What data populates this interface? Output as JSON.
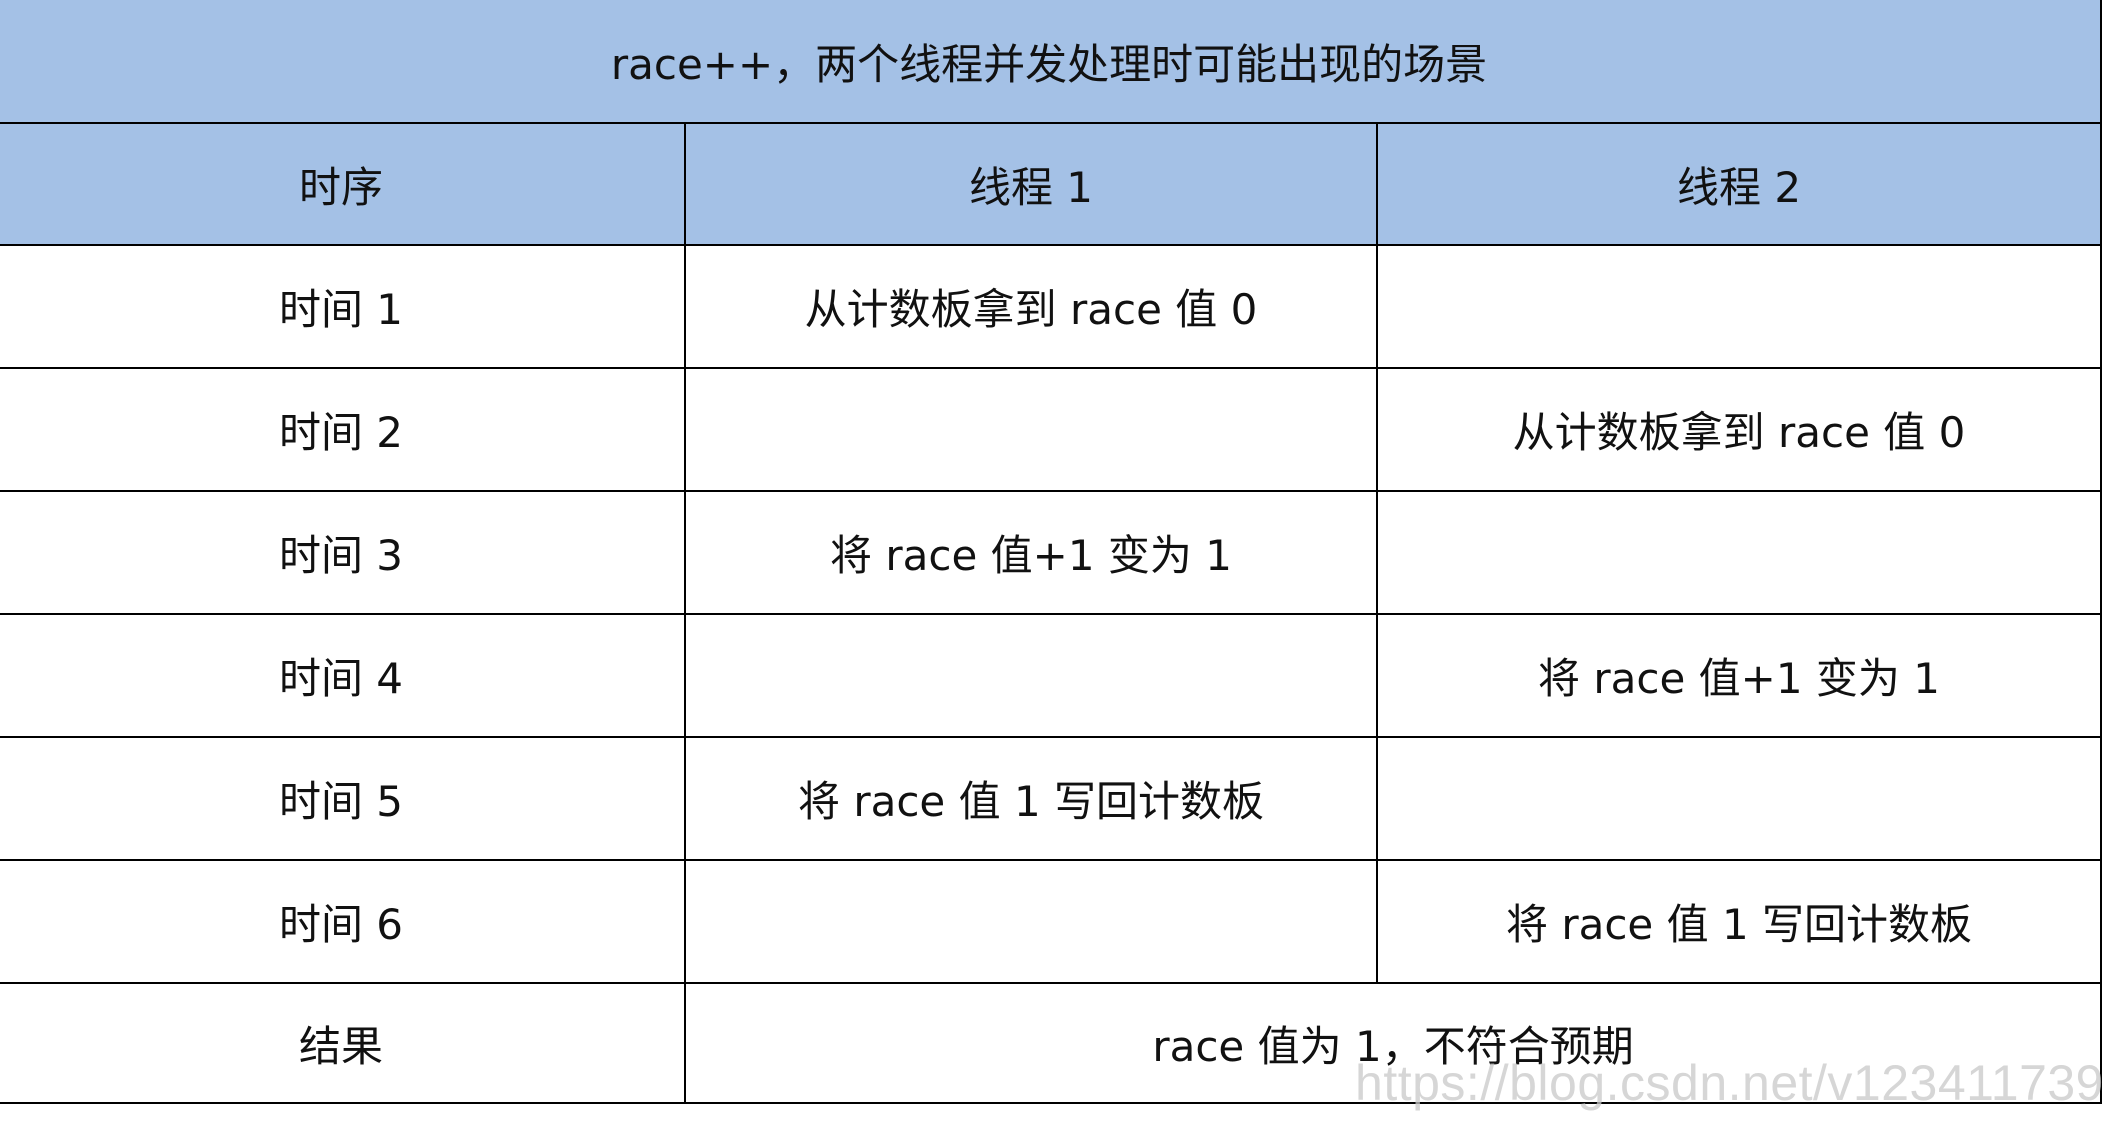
{
  "table": {
    "title": "race++，两个线程并发处理时可能出现的场景",
    "headers": [
      "时序",
      "线程 1",
      "线程 2"
    ],
    "rows": [
      {
        "time": "时间 1",
        "thread1": "从计数板拿到 race 值 0",
        "thread2": ""
      },
      {
        "time": "时间 2",
        "thread1": "",
        "thread2": "从计数板拿到 race 值 0"
      },
      {
        "time": "时间 3",
        "thread1": "将 race 值+1 变为 1",
        "thread2": ""
      },
      {
        "time": "时间 4",
        "thread1": "",
        "thread2": "将 race 值+1 变为 1"
      },
      {
        "time": "时间 5",
        "thread1": "将 race 值 1 写回计数板",
        "thread2": ""
      },
      {
        "time": "时间 6",
        "thread1": "",
        "thread2": "将 race 值 1 写回计数板"
      }
    ],
    "result": {
      "label": "结果",
      "value": "race 值为 1，不符合预期"
    }
  },
  "watermark": "https://blog.csdn.net/v123411739"
}
